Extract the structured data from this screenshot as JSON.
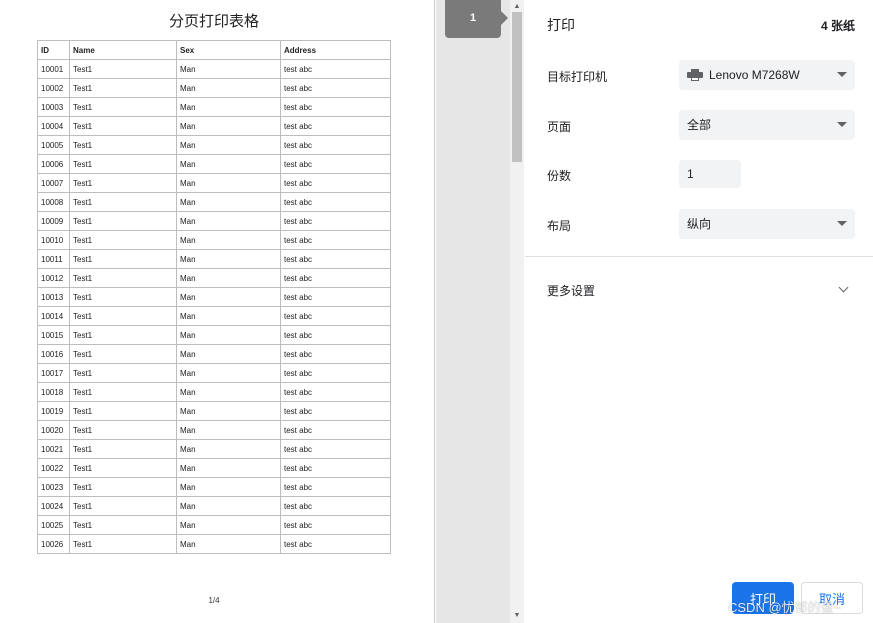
{
  "document": {
    "title": "分页打印表格",
    "columns": [
      "ID",
      "Name",
      "Sex",
      "Address"
    ],
    "rows": [
      [
        "10001",
        "Test1",
        "Man",
        "test abc"
      ],
      [
        "10002",
        "Test1",
        "Man",
        "test abc"
      ],
      [
        "10003",
        "Test1",
        "Man",
        "test abc"
      ],
      [
        "10004",
        "Test1",
        "Man",
        "test abc"
      ],
      [
        "10005",
        "Test1",
        "Man",
        "test abc"
      ],
      [
        "10006",
        "Test1",
        "Man",
        "test abc"
      ],
      [
        "10007",
        "Test1",
        "Man",
        "test abc"
      ],
      [
        "10008",
        "Test1",
        "Man",
        "test abc"
      ],
      [
        "10009",
        "Test1",
        "Man",
        "test abc"
      ],
      [
        "10010",
        "Test1",
        "Man",
        "test abc"
      ],
      [
        "10011",
        "Test1",
        "Man",
        "test abc"
      ],
      [
        "10012",
        "Test1",
        "Man",
        "test abc"
      ],
      [
        "10013",
        "Test1",
        "Man",
        "test abc"
      ],
      [
        "10014",
        "Test1",
        "Man",
        "test abc"
      ],
      [
        "10015",
        "Test1",
        "Man",
        "test abc"
      ],
      [
        "10016",
        "Test1",
        "Man",
        "test abc"
      ],
      [
        "10017",
        "Test1",
        "Man",
        "test abc"
      ],
      [
        "10018",
        "Test1",
        "Man",
        "test abc"
      ],
      [
        "10019",
        "Test1",
        "Man",
        "test abc"
      ],
      [
        "10020",
        "Test1",
        "Man",
        "test abc"
      ],
      [
        "10021",
        "Test1",
        "Man",
        "test abc"
      ],
      [
        "10022",
        "Test1",
        "Man",
        "test abc"
      ],
      [
        "10023",
        "Test1",
        "Man",
        "test abc"
      ],
      [
        "10024",
        "Test1",
        "Man",
        "test abc"
      ],
      [
        "10025",
        "Test1",
        "Man",
        "test abc"
      ],
      [
        "10026",
        "Test1",
        "Man",
        "test abc"
      ]
    ],
    "page_indicator": "1/4"
  },
  "thumbnail": {
    "page_number": "1"
  },
  "panel": {
    "title": "打印",
    "sheet_count": "4 张纸",
    "destination": {
      "label": "目标打印机",
      "value": "Lenovo M7268W",
      "icon": "printer-icon"
    },
    "pages": {
      "label": "页面",
      "value": "全部"
    },
    "copies": {
      "label": "份数",
      "value": "1"
    },
    "layout": {
      "label": "布局",
      "value": "纵向"
    },
    "more_settings": {
      "label": "更多设置",
      "icon": "chevron-down-icon"
    },
    "print_button": "打印",
    "cancel_button": "取消",
    "accent_color": "#1a73e8"
  },
  "watermark": "CSDN @忧郁的蛋~"
}
